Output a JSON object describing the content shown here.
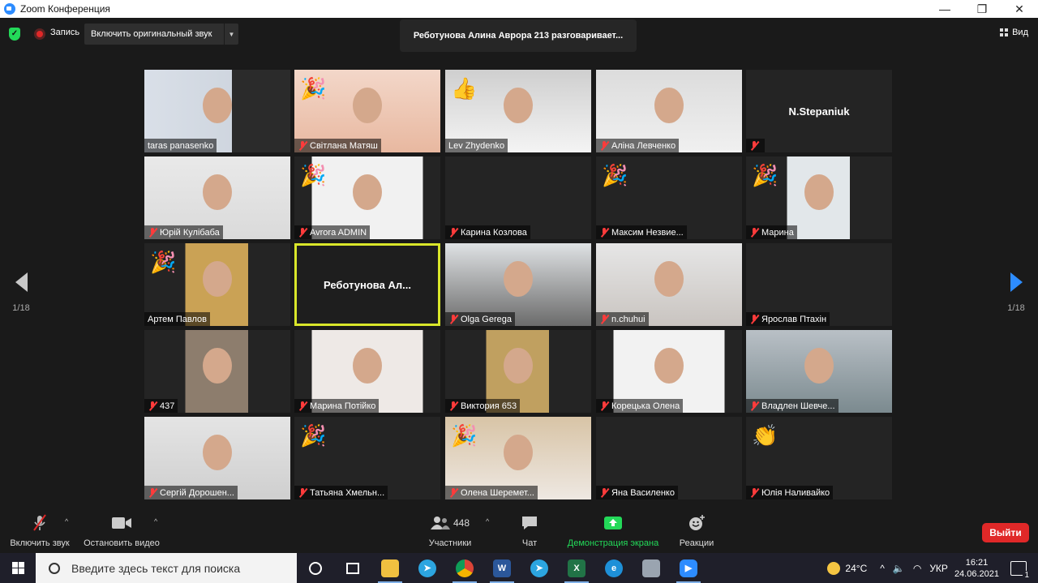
{
  "window": {
    "title": "Zoom Конференция",
    "minimize": "—",
    "restore": "❐",
    "close": "✕"
  },
  "topbar": {
    "record_label": "Запись",
    "original_sound": "Включить оригинальный звук",
    "speaking": "Реботунова Алина Аврора 213 разговаривает...",
    "view_label": "Вид"
  },
  "pager": {
    "left_count": "1/18",
    "right_count": "1/18"
  },
  "tiles": [
    {
      "name": "taras panasenko",
      "muted": false
    },
    {
      "name": "Світлана Матяш",
      "muted": true,
      "emoji": "🎉"
    },
    {
      "name": "Lev Zhydenko",
      "muted": false,
      "emoji": "👍"
    },
    {
      "name": "Аліна Левченко",
      "muted": true
    },
    {
      "name": "",
      "muted": true,
      "center": "N.Stepaniuk"
    },
    {
      "name": "Юрій Кулібаба",
      "muted": true
    },
    {
      "name": "Avrora ADMIN",
      "muted": true,
      "emoji": "🎉"
    },
    {
      "name": "Карина Козлова",
      "muted": true
    },
    {
      "name": "Максим Незвие...",
      "muted": true,
      "emoji": "🎉"
    },
    {
      "name": "Марина",
      "muted": true,
      "emoji": "🎉"
    },
    {
      "name": "Артем Павлов",
      "muted": false,
      "emoji": "🎉"
    },
    {
      "name": "",
      "muted": false,
      "center": "Реботунова Ал..."
    },
    {
      "name": "Olga Gerega",
      "muted": true
    },
    {
      "name": "n.chuhui",
      "muted": true
    },
    {
      "name": "Ярослав Птахін",
      "muted": true
    },
    {
      "name": "437",
      "muted": true
    },
    {
      "name": "Марина Потійко",
      "muted": true
    },
    {
      "name": "Виктория 653",
      "muted": true
    },
    {
      "name": "Корецька Олена",
      "muted": true
    },
    {
      "name": "Владлен Шевче...",
      "muted": true
    },
    {
      "name": "Сергій Дорошен...",
      "muted": true
    },
    {
      "name": "Татьяна Хмельн...",
      "muted": true,
      "emoji": "🎉"
    },
    {
      "name": "Олена Шеремет...",
      "muted": true,
      "emoji": "🎉"
    },
    {
      "name": "Яна Василенко",
      "muted": true
    },
    {
      "name": "Юлія Наливайко",
      "muted": true,
      "emoji": "👏"
    }
  ],
  "toolbar": {
    "unmute": "Включить звук",
    "start_video": "Остановить видео",
    "participants_count": "448",
    "participants": "Участники",
    "chat": "Чат",
    "share": "Демонстрация экрана",
    "reactions": "Реакции",
    "leave": "Выйти"
  },
  "taskbar": {
    "search_placeholder": "Введите здесь текст для поиска",
    "temperature": "24°C",
    "language": "УКР",
    "time": "16:21",
    "date": "24.06.2021",
    "notifications": "1"
  },
  "colors": {
    "accent": "#2D8CFF",
    "active_speaker": "#d9e62a",
    "share_green": "#23d959",
    "leave_red": "#e02828"
  }
}
